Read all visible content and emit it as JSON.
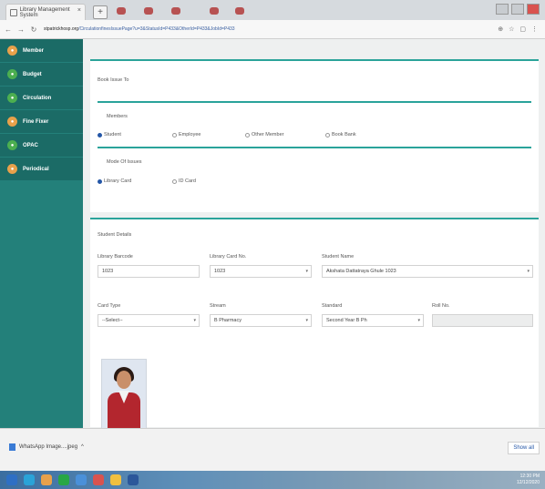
{
  "browser": {
    "tab_title": "Library Management System",
    "url_host": "stpatrickhosp.org",
    "url_path": "/CirculationfinesIssuePage?u=3&StatusId=P433&OtherId=P433&JobId=P433",
    "new_tab": "+",
    "tab_close": "×"
  },
  "sidebar": {
    "items": [
      {
        "label": "Member",
        "icon": "member-icon"
      },
      {
        "label": "Budget",
        "icon": "budget-icon"
      },
      {
        "label": "Circulation",
        "icon": "circulation-icon"
      },
      {
        "label": "Fine Fixer",
        "icon": "fine-icon"
      },
      {
        "label": "OPAC",
        "icon": "opac-icon"
      },
      {
        "label": "Periodical",
        "icon": "periodical-icon"
      }
    ]
  },
  "issue_form": {
    "book_issue_to": "Book Issue To",
    "members_label": "Members",
    "member_types": [
      {
        "label": "Student",
        "selected": true
      },
      {
        "label": "Employee",
        "selected": false
      },
      {
        "label": "Other Member",
        "selected": false
      },
      {
        "label": "Book Bank",
        "selected": false
      }
    ],
    "mode_label": "Mode Of Issues",
    "modes": [
      {
        "label": "Library Card",
        "selected": true
      },
      {
        "label": "ID Card",
        "selected": false
      }
    ]
  },
  "student_details": {
    "heading": "Student Details",
    "library_barcode_label": "Library Barcode",
    "library_barcode_value": "1023",
    "library_card_label": "Library Card No.",
    "library_card_value": "1023",
    "student_name_label": "Student Name",
    "student_name_value": "Akshata Dattatraya Ghule 1023",
    "card_type_label": "Card Type",
    "card_type_value": "--Select--",
    "stream_label": "Stream",
    "stream_value": "B Pharmacy",
    "standard_label": "Standard",
    "standard_value": "Second Year B Ph",
    "roll_label": "Roll No.",
    "roll_value": ""
  },
  "downloads": {
    "file_name": "WhatsApp Image....jpeg",
    "show_all": "Show all"
  },
  "taskbar": {
    "time": "12:30 PM",
    "date": "12/12/2020"
  }
}
